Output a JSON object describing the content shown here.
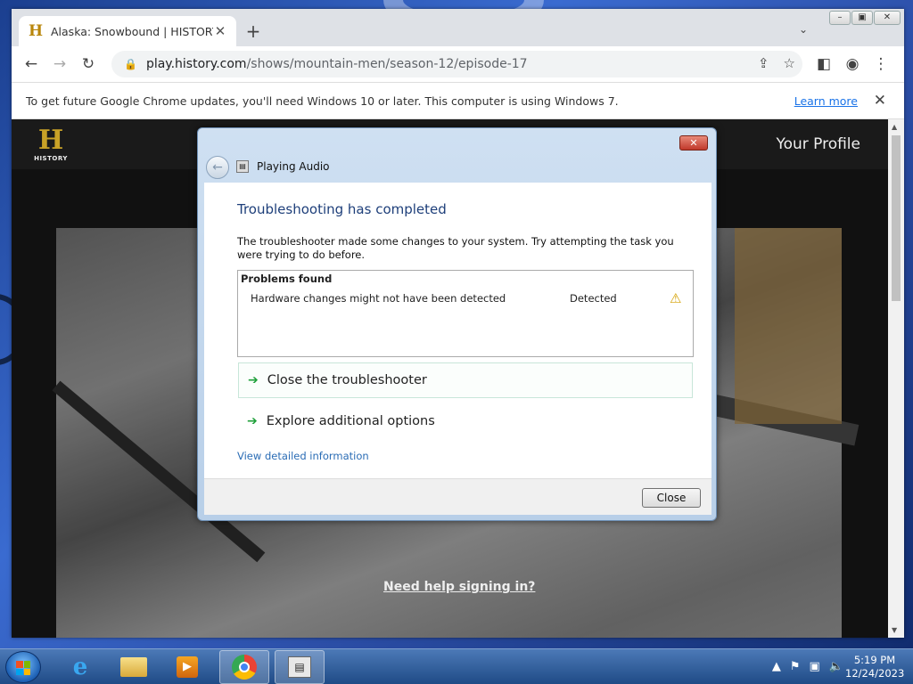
{
  "browser": {
    "tab": {
      "favicon": "history-h-icon",
      "title": "Alaska: Snowbound | HISTORY"
    },
    "url": {
      "host": "play.history.com",
      "path": "/shows/mountain-men/season-12/episode-17"
    },
    "infobar": {
      "message": "To get future Google Chrome updates, you'll need Windows 10 or later. This computer is using Windows 7.",
      "learn_more": "Learn more"
    }
  },
  "page": {
    "logo_letter": "H",
    "logo_word": "HISTORY",
    "your_profile": "Your Profile",
    "need_help": "Need help signing in?"
  },
  "dialog": {
    "title": "Playing Audio",
    "heading": "Troubleshooting has completed",
    "description": "The troubleshooter made some changes to your system. Try attempting the task you were trying to do before.",
    "problems_header": "Problems found",
    "problems": [
      {
        "name": "Hardware changes might not have been detected",
        "status": "Detected",
        "icon": "warning-icon"
      }
    ],
    "options": [
      "Close the troubleshooter",
      "Explore additional options"
    ],
    "view_detailed": "View detailed information",
    "close_button": "Close"
  },
  "taskbar": {
    "apps": [
      "internet-explorer",
      "windows-explorer",
      "media-player",
      "google-chrome",
      "troubleshooter"
    ],
    "time": "5:19 PM",
    "date": "12/24/2023"
  },
  "colors": {
    "history_gold": "#c9a227",
    "dialog_heading": "#1e3f7a",
    "link": "#2a6cb5",
    "option_arrow": "#1fa03a"
  }
}
